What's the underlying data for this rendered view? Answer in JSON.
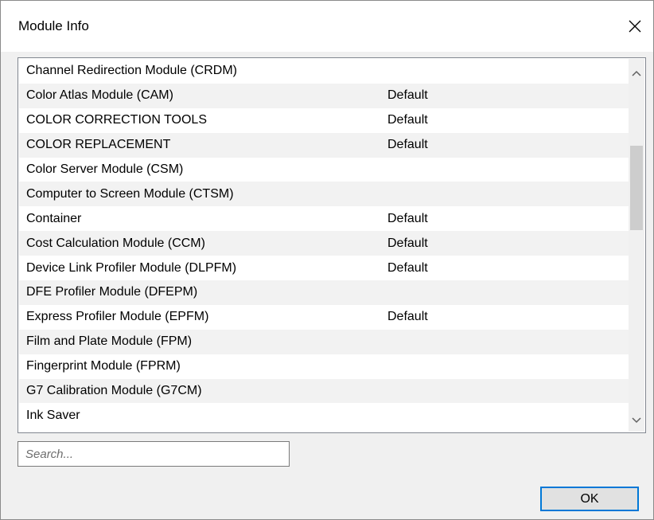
{
  "window": {
    "title": "Module Info"
  },
  "modules": [
    {
      "name": "Channel Redirection Module (CRDM)",
      "status": ""
    },
    {
      "name": "Color Atlas Module (CAM)",
      "status": "Default"
    },
    {
      "name": "COLOR CORRECTION TOOLS",
      "status": "Default"
    },
    {
      "name": "COLOR REPLACEMENT",
      "status": "Default"
    },
    {
      "name": "Color Server Module (CSM)",
      "status": ""
    },
    {
      "name": "Computer to Screen Module (CTSM)",
      "status": ""
    },
    {
      "name": "Container",
      "status": "Default"
    },
    {
      "name": "Cost Calculation Module (CCM)",
      "status": "Default"
    },
    {
      "name": "Device Link Profiler Module (DLPFM)",
      "status": "Default"
    },
    {
      "name": "DFE Profiler Module (DFEPM)",
      "status": ""
    },
    {
      "name": "Express Profiler Module (EPFM)",
      "status": "Default"
    },
    {
      "name": "Film and Plate Module (FPM)",
      "status": ""
    },
    {
      "name": "Fingerprint Module (FPRM)",
      "status": ""
    },
    {
      "name": "G7 Calibration Module (G7CM)",
      "status": ""
    },
    {
      "name": "Ink Saver",
      "status": ""
    }
  ],
  "search": {
    "placeholder": "Search...",
    "value": ""
  },
  "buttons": {
    "ok_label": "OK"
  },
  "icons": {
    "close": "close-icon",
    "scroll_up": "chevron-up-icon",
    "scroll_down": "chevron-down-icon"
  },
  "colors": {
    "focus_border": "#0078d7",
    "row_alt": "#f2f2f2"
  }
}
